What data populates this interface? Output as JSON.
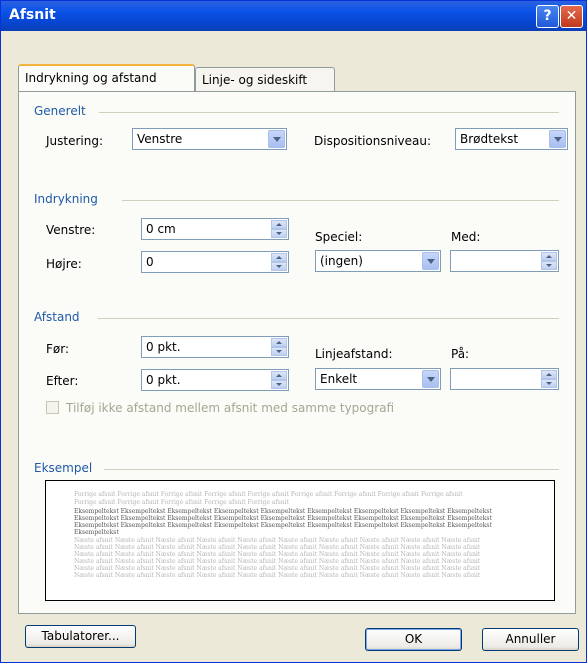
{
  "window": {
    "title": "Afsnit",
    "help_label": "?",
    "close_label": "✕"
  },
  "tabs": [
    {
      "label": "Indrykning og afstand"
    },
    {
      "label": "Linje- og sideskift"
    }
  ],
  "general": {
    "heading": "Generelt",
    "alignment_label": "Justering:",
    "alignment_value": "Venstre",
    "outline_label": "Dispositionsniveau:",
    "outline_value": "Brødtekst"
  },
  "indent": {
    "heading": "Indrykning",
    "left_label": "Venstre:",
    "left_value": "0 cm",
    "right_label": "Højre:",
    "right_value": "0",
    "special_label": "Speciel:",
    "special_value": "(ingen)",
    "by_label": "Med:",
    "by_value": ""
  },
  "spacing": {
    "heading": "Afstand",
    "before_label": "Før:",
    "before_value": "0 pkt.",
    "after_label": "Efter:",
    "after_value": "0 pkt.",
    "line_spacing_label": "Linjeafstand:",
    "line_spacing_value": "Enkelt",
    "at_label": "På:",
    "at_value": "",
    "no_space_checkbox_label": "Tilføj ikke afstand mellem afsnit med samme typografi"
  },
  "preview": {
    "heading": "Eksempel",
    "prev_line": "Forrige afsnit Forrige afsnit Forrige afsnit Forrige afsnit Forrige afsnit Forrige afsnit Forrige afsnit Forrige afsnit Forrige afsnit",
    "prev_line2": "Forrige afsnit Forrige afsnit Forrige afsnit Forrige afsnit Forrige afsnit",
    "sample_line": "Eksempeltekst Eksempeltekst Eksempeltekst Eksempeltekst Eksempeltekst Eksempeltekst Eksempeltekst Eksempeltekst Eksempeltekst",
    "sample_short": "Eksempeltekst",
    "next_line": "Næste afsnit Næste afsnit Næste afsnit Næste afsnit Næste afsnit Næste afsnit Næste afsnit Næste afsnit Næste afsnit Næste afsnit"
  },
  "buttons": {
    "tabs": "Tabulatorer...",
    "ok": "OK",
    "cancel": "Annuller"
  }
}
